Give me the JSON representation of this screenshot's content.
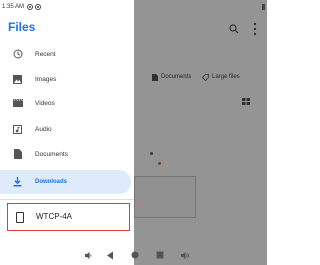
{
  "status_bar": {
    "time": "1:35 AM"
  },
  "drawer": {
    "title": "Files",
    "items": [
      {
        "label": "Recent",
        "icon": "clock-icon"
      },
      {
        "label": "Images",
        "icon": "image-icon"
      },
      {
        "label": "Videos",
        "icon": "film-icon"
      },
      {
        "label": "Audio",
        "icon": "music-icon"
      },
      {
        "label": "Documents",
        "icon": "document-icon"
      },
      {
        "label": "Downloads",
        "icon": "download-icon",
        "selected": true
      }
    ],
    "device": {
      "label": "WTCP-4A",
      "icon": "phone-icon"
    }
  },
  "background": {
    "chips": [
      "Documents",
      "Large files"
    ]
  },
  "colors": {
    "accent": "#1a73e8",
    "selected_bg": "#ddebfb",
    "highlight_border": "#e53935",
    "scrim": "rgba(0,0,0,0.42)"
  }
}
